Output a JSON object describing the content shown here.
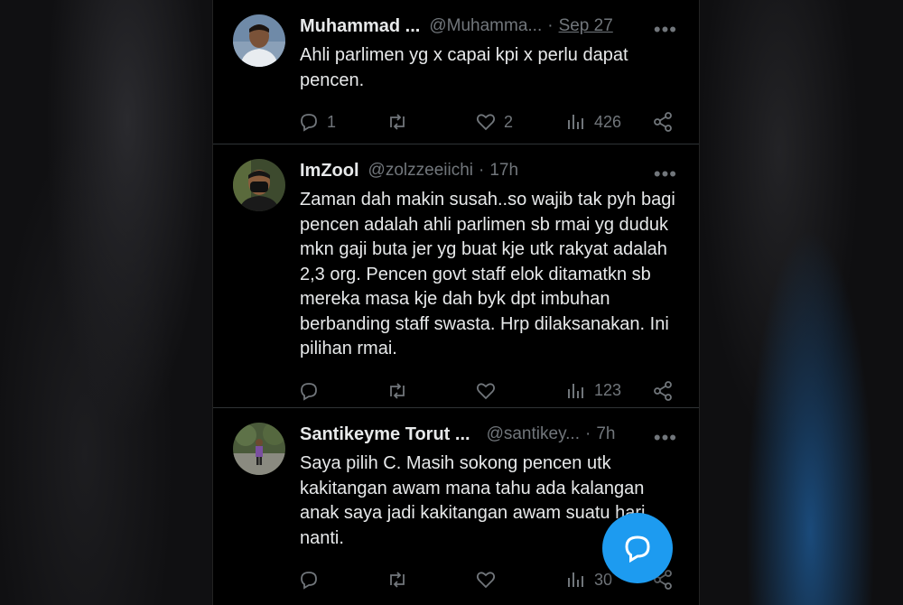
{
  "tweets": [
    {
      "name": "Muhammad ...",
      "handle": "@Muhamma...",
      "time": "Sep 27",
      "text": "Ahli parlimen yg x capai kpi x perlu dapat pencen.",
      "replies": "1",
      "likes": "2",
      "views": "426"
    },
    {
      "name": "ImZool",
      "handle": "@zolzzeeiichi",
      "time": "17h",
      "text": "Zaman dah makin susah..so wajib tak pyh bagi pencen adalah ahli parlimen sb rmai yg duduk mkn gaji buta jer yg buat kje utk rakyat adalah 2,3 org. Pencen govt staff elok ditamatkn sb mereka masa kje dah byk dpt imbuhan berbanding staff swasta. Hrp dilaksanakan. Ini pilihan rmai.",
      "replies": "",
      "likes": "",
      "views": "123"
    },
    {
      "name": "Santikeyme Torut ...",
      "handle": "@santikey...",
      "time": "7h",
      "text": "Saya pilih C. Masih sokong pencen utk kakitangan awam mana tahu ada kalangan anak saya jadi kakitangan awam suatu hari nanti.",
      "replies": "",
      "likes": "",
      "views": "30"
    }
  ],
  "separator": "·",
  "more_glyph": "•••",
  "colors": {
    "accent": "#1d9bf0",
    "muted": "#71767b",
    "text": "#e7e9ea",
    "background": "#000000"
  }
}
